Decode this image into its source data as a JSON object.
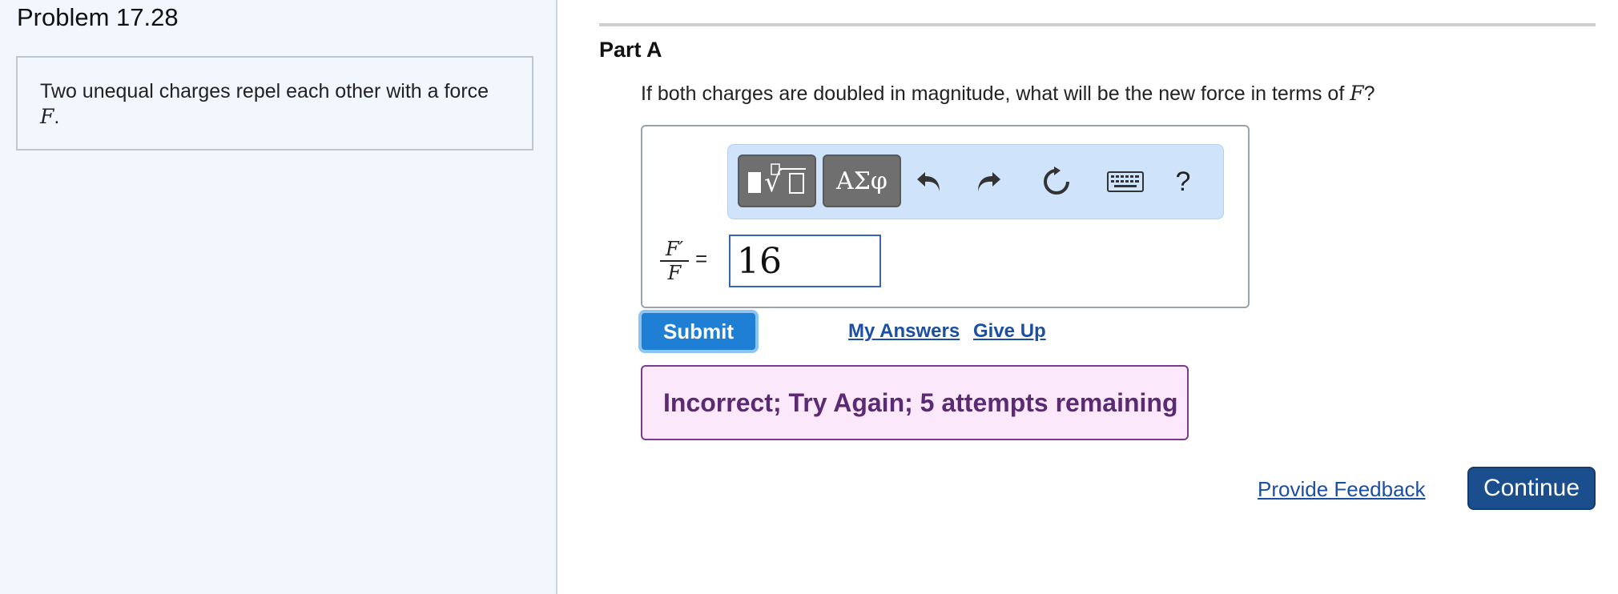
{
  "problem": {
    "title": "Problem 17.28",
    "text": "Two unequal charges repel each other with a force ",
    "force_var": "F",
    "text_end": "."
  },
  "part": {
    "label": "Part A",
    "question_text": "If both charges are doubled in magnitude, what will be the new force in terms of ",
    "question_var": "F",
    "question_end": "?"
  },
  "toolbar": {
    "templates_icon": "fraction-sqrt-templates-icon",
    "greek_label": "ΑΣφ",
    "undo_icon": "undo-icon",
    "redo_icon": "redo-icon",
    "reset_icon": "reset-icon",
    "keyboard_icon": "keyboard-icon",
    "help_label": "?"
  },
  "answer": {
    "numerator": "F′",
    "denominator": "F",
    "equals": "=",
    "value": "16"
  },
  "actions": {
    "submit_label": "Submit",
    "my_answers_label": "My Answers",
    "give_up_label": "Give Up"
  },
  "feedback": {
    "message": "Incorrect; Try Again; 5 attempts remaining"
  },
  "footer": {
    "provide_feedback_label": "Provide Feedback",
    "continue_label": "Continue"
  },
  "colors": {
    "left_pane_bg": "#f2f7fe",
    "toolbar_bg": "#cfe4fb",
    "submit_bg": "#1f7fd4",
    "feedback_bg": "#fbe9fb",
    "feedback_text": "#5b2a73",
    "continue_bg": "#1b4e8c",
    "link": "#1a4fa3"
  }
}
